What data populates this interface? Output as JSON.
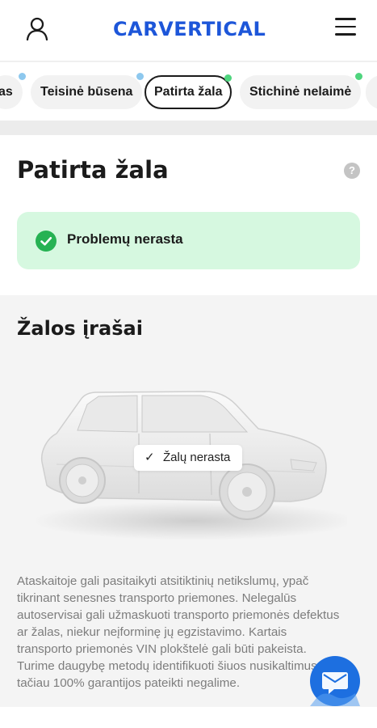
{
  "header": {
    "logo_text": "CARVERTICAL",
    "user_icon": "user-icon",
    "menu_icon": "hamburger-menu-icon",
    "brand_color": "#1d56d9"
  },
  "tabs": [
    {
      "label": "as",
      "dot": "blue"
    },
    {
      "label": "Teisinė būsena",
      "dot": "blue"
    },
    {
      "label": "Patirta žala",
      "dot": "green",
      "active": true
    },
    {
      "label": "Stichinė nelaimė",
      "dot": "green"
    }
  ],
  "damage_section": {
    "title": "Patirta žala",
    "help_icon": "?",
    "status_text": "Problemų nerasta",
    "status_color": "#26b253"
  },
  "records_section": {
    "title": "Žalos įrašai",
    "badge_tick": "✓",
    "badge_text": "Žalų nerasta",
    "description": "Ataskaitoje gali pasitaikyti atsitiktinių netikslumų, ypač tikrinant senesnes transporto priemones. Nelegalūs autoservisai gali užmaskuoti transporto priemonės defektus ar žalas, niekur neįforminę jų egzistavimo. Kartais transporto priemonės VIN plokštelė gali būti pakeista. Turime daugybę metodų identifikuoti šiuos nusikaltimus, tačiau 100% garantijos pateikti negalime."
  },
  "chat": {
    "icon": "chat-icon",
    "color": "#1d6fe0"
  }
}
